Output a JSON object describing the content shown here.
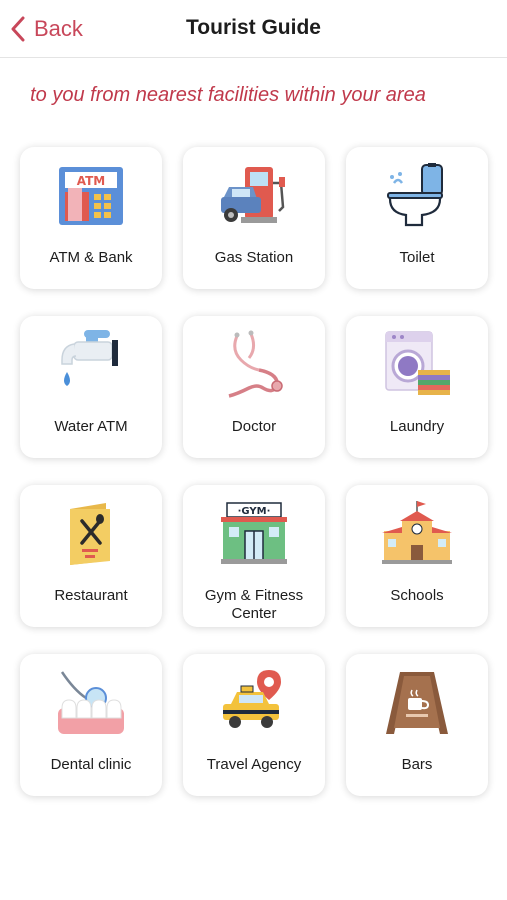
{
  "header": {
    "back_label": "Back",
    "title": "Tourist Guide"
  },
  "ticker": {
    "text": "Information available to you from nearest facilities within your area"
  },
  "colors": {
    "accent": "#c8475a",
    "ticker": "#c0394b"
  },
  "facilities": [
    {
      "label": "ATM & Bank",
      "icon": "atm-icon"
    },
    {
      "label": "Gas Station",
      "icon": "gas-station-icon"
    },
    {
      "label": "Toilet",
      "icon": "toilet-icon"
    },
    {
      "label": "Water ATM",
      "icon": "water-tap-icon"
    },
    {
      "label": "Doctor",
      "icon": "stethoscope-icon"
    },
    {
      "label": "Laundry",
      "icon": "washing-machine-icon"
    },
    {
      "label": "Restaurant",
      "icon": "menu-cutlery-icon"
    },
    {
      "label": "Gym & Fitness Center",
      "icon": "gym-building-icon"
    },
    {
      "label": "Schools",
      "icon": "school-building-icon"
    },
    {
      "label": "Dental clinic",
      "icon": "dental-icon"
    },
    {
      "label": "Travel Agency",
      "icon": "taxi-location-icon"
    },
    {
      "label": "Bars",
      "icon": "coffee-board-icon"
    }
  ]
}
